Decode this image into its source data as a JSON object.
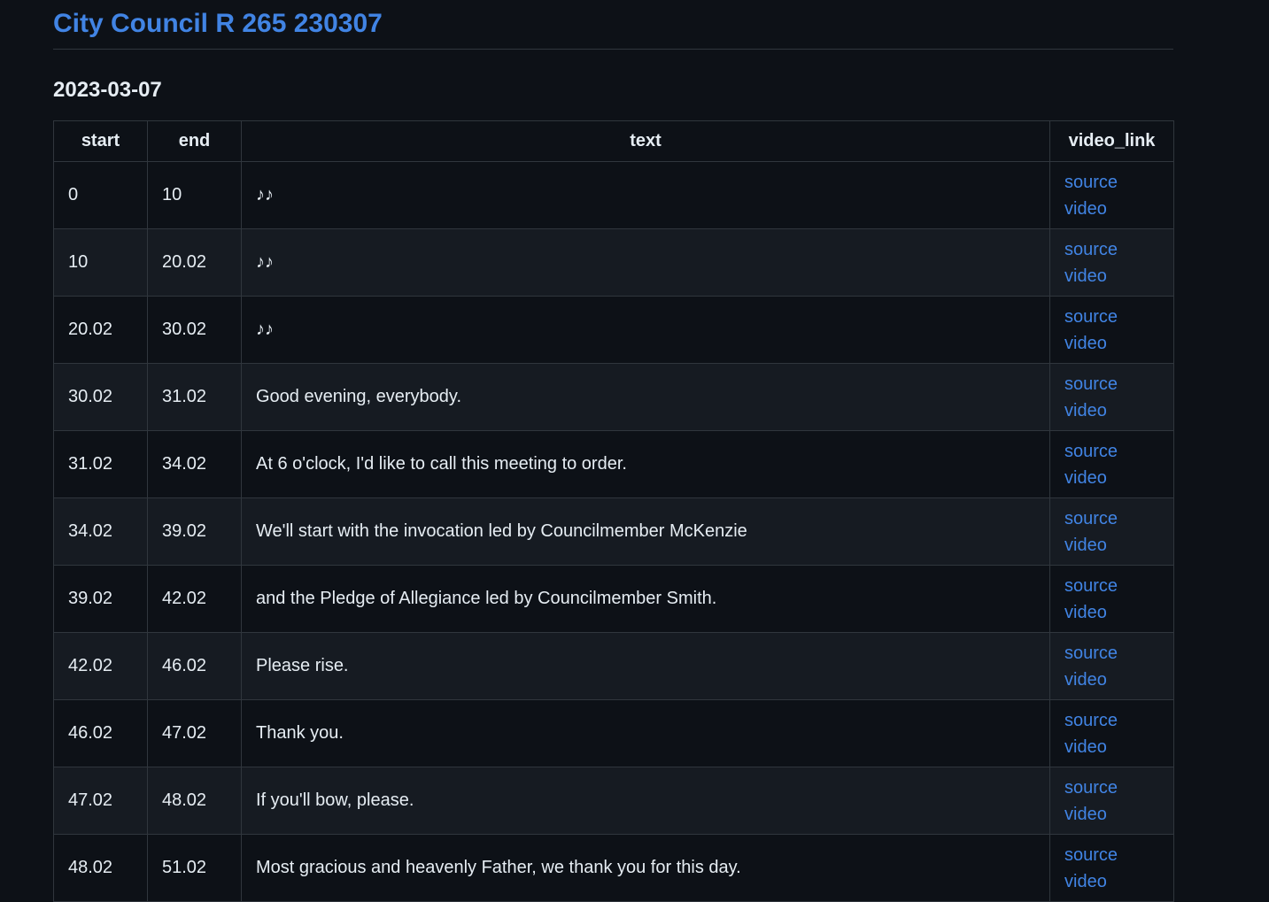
{
  "page": {
    "title": "City Council R 265 230307",
    "date": "2023-03-07"
  },
  "table": {
    "headers": [
      "start",
      "end",
      "text",
      "video_link"
    ],
    "link_label_line1": "source",
    "link_label_line2": "video",
    "rows": [
      {
        "start": "0",
        "end": "10",
        "text": "♪♪"
      },
      {
        "start": "10",
        "end": "20.02",
        "text": "♪♪"
      },
      {
        "start": "20.02",
        "end": "30.02",
        "text": "♪♪"
      },
      {
        "start": "30.02",
        "end": "31.02",
        "text": "Good evening, everybody."
      },
      {
        "start": "31.02",
        "end": "34.02",
        "text": "At 6 o'clock, I'd like to call this meeting to order."
      },
      {
        "start": "34.02",
        "end": "39.02",
        "text": "We'll start with the invocation led by Councilmember McKenzie"
      },
      {
        "start": "39.02",
        "end": "42.02",
        "text": "and the Pledge of Allegiance led by Councilmember Smith."
      },
      {
        "start": "42.02",
        "end": "46.02",
        "text": "Please rise."
      },
      {
        "start": "46.02",
        "end": "47.02",
        "text": "Thank you."
      },
      {
        "start": "47.02",
        "end": "48.02",
        "text": "If you'll bow, please."
      },
      {
        "start": "48.02",
        "end": "51.02",
        "text": "Most gracious and heavenly Father, we thank you for this day."
      }
    ]
  }
}
